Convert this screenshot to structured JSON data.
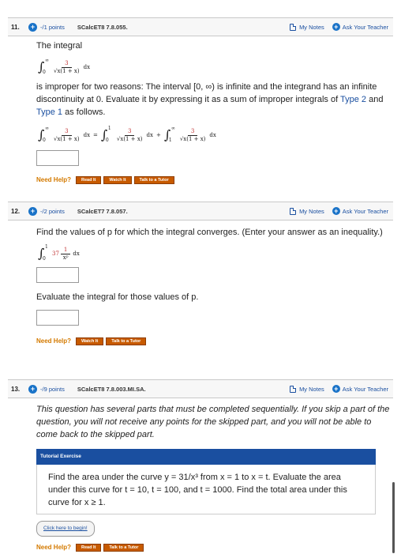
{
  "problems": [
    {
      "number": "11.",
      "points": "-/1 points",
      "code": "SCalcET8 7.8.055.",
      "my_notes": "My Notes",
      "ask_teacher": "Ask Your Teacher",
      "intro": "The integral",
      "text": "is improper for two reasons: The interval [0, ∞) is infinite and the integrand has an infinite discontinuity at 0. Evaluate it by expressing it as a sum of improper integrals of",
      "type2": "Type 2",
      "and": "and",
      "type1": "Type 1",
      "as_follows": "as follows.",
      "need_help": "Need Help?",
      "buttons": [
        "Read It",
        "Watch It",
        "Talk to a Tutor"
      ]
    },
    {
      "number": "12.",
      "points": "-/2 points",
      "code": "SCalcET7 7.8.057.",
      "my_notes": "My Notes",
      "ask_teacher": "Ask Your Teacher",
      "text": "Find the values of p for which the integral converges. (Enter your answer as an inequality.)",
      "text2": "Evaluate the integral for those values of p.",
      "need_help": "Need Help?",
      "buttons": [
        "Watch It",
        "Talk to a Tutor"
      ]
    },
    {
      "number": "13.",
      "points": "-/9 points",
      "code": "SCalcET8 7.8.003.MI.SA.",
      "my_notes": "My Notes",
      "ask_teacher": "Ask Your Teacher",
      "text": "This question has several parts that must be completed sequentially. If you skip a part of the question, you will not receive any points for the skipped part, and you will not be able to come back to the skipped part.",
      "tutorial_label": "Tutorial Exercise",
      "tutorial_text": "Find the area under the curve y = 31/x³ from x = 1 to x = t. Evaluate the area under this curve for t = 10, t = 100, and t = 1000. Find the total area under this curve for x ≥ 1.",
      "begin": "Click here to begin!",
      "need_help": "Need Help?",
      "buttons": [
        "Read It",
        "Talk to a Tutor"
      ]
    }
  ],
  "math": {
    "inf": "∞",
    "zero": "0",
    "one": "1",
    "num3": "3",
    "den": "√x(1 + x)",
    "dx": "dx",
    "eq": "=",
    "plus": "+",
    "num37": "37",
    "num1": "1",
    "xp": "xᵖ"
  }
}
